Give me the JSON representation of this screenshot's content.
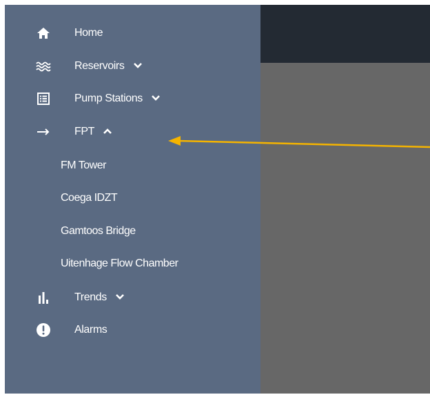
{
  "sidebar": {
    "items": [
      {
        "label": "Home",
        "icon": "home-icon"
      },
      {
        "label": "Reservoirs",
        "icon": "waves-icon",
        "chevron": "chevron-down-icon"
      },
      {
        "label": "Pump Stations",
        "icon": "list-icon",
        "chevron": "chevron-down-icon"
      },
      {
        "label": "FPT",
        "icon": "arrow-right-icon",
        "chevron": "chevron-up-icon"
      },
      {
        "label": "Trends",
        "icon": "bar-chart-icon",
        "chevron": "chevron-down-icon"
      },
      {
        "label": "Alarms",
        "icon": "alert-icon"
      }
    ],
    "fpt_subitems": [
      {
        "label": "FM Tower"
      },
      {
        "label": "Coega IDZT"
      },
      {
        "label": "Gamtoos Bridge"
      },
      {
        "label": "Uitenhage Flow Chamber"
      }
    ]
  },
  "colors": {
    "sidebar_bg": "#5a6a82",
    "topbar_bg": "#232a33",
    "content_bg": "#676767",
    "annotation_arrow": "#f5b400"
  }
}
